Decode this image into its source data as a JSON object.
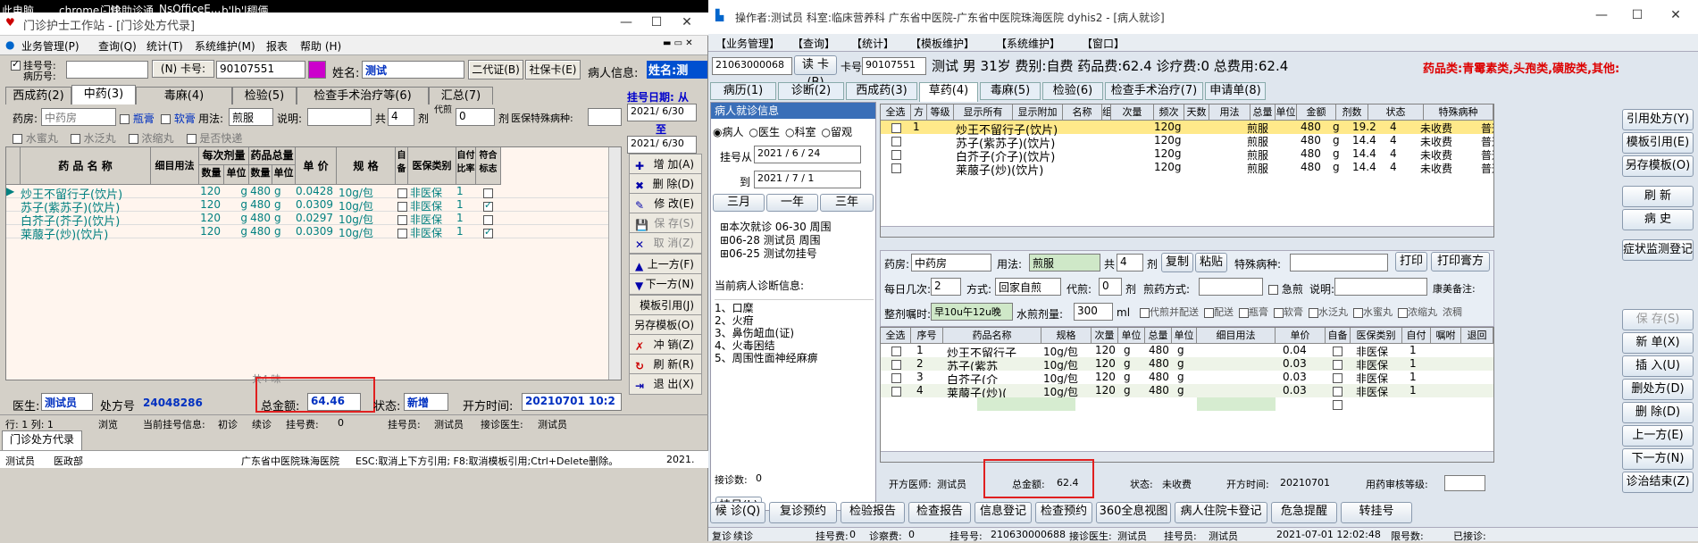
{
  "taskbar": [
    "此电脑",
    "chrome - 快",
    "门诊助诊通",
    "NsOfficeE...",
    "b'lb'l稠俩"
  ],
  "left": {
    "title": "门诊护士工作站 - [门诊处方代录]",
    "menu": [
      "业务管理(P)",
      "查询(Q)",
      "统计(T)",
      "系统维护(M)",
      "报表",
      "帮助 (H)"
    ],
    "reg_label": "挂号号:",
    "rec_label": "病历号:",
    "card_btn": "(N) 卡号:",
    "card_no": "90107551",
    "name_label": "姓名:",
    "name_val": "测试",
    "btn_id2": "二代证(B)",
    "btn_social": "社保卡(E)",
    "patient_info_label": "病人信息:",
    "patient_info_val": "姓名:测",
    "tabs": [
      "西成药(2)",
      "中药(3)",
      "毒麻(4)",
      "检验(5)",
      "检查手术治疗等(6)",
      "汇总(7)"
    ],
    "pharmacy_label": "药房:",
    "pharmacy": "中药房",
    "dict1": "瓶膏",
    "dict2": "软膏",
    "usage_label": "用法:",
    "usage": "煎服",
    "note_label": "说明:",
    "total_label": "共",
    "total": "4",
    "dose_unit": "剂",
    "decoct": "代煎",
    "decoct_val": "0",
    "decoct_unit": "剂",
    "special": "医保特殊病种:",
    "opts": [
      "水蜜丸",
      "水泛丸",
      "浓缩丸",
      "是否快递"
    ],
    "hdr": {
      "name": "药 品 名 称",
      "usage": "细目用法",
      "per": "每次剂量",
      "tot": "药品总量",
      "qty": "数量",
      "unit": "单位",
      "qty2": "数量",
      "unit2": "单位",
      "price": "单 价",
      "spec": "规 格",
      "self": "自备",
      "ins": "医保类别",
      "ratio": "自付比率",
      "flag": "符合标志"
    },
    "rows": [
      {
        "name": "炒王不留行子(饮片)",
        "q": "120",
        "u": "g",
        "q2": "480",
        "u2": "g",
        "price": "0.0428",
        "spec": "10g/包",
        "ins": "非医保",
        "r": "1",
        "f": false
      },
      {
        "name": "苏子(紫苏子)(饮片)",
        "q": "120",
        "u": "g",
        "q2": "480",
        "u2": "g",
        "price": "0.0309",
        "spec": "10g/包",
        "ins": "非医保",
        "r": "1",
        "f": true
      },
      {
        "name": "白芥子(芥子)(饮片)",
        "q": "120",
        "u": "g",
        "q2": "480",
        "u2": "g",
        "price": "0.0297",
        "spec": "10g/包",
        "ins": "非医保",
        "r": "1",
        "f": false
      },
      {
        "name": "莱菔子(炒)(饮片)",
        "q": "120",
        "u": "g",
        "q2": "480",
        "u2": "g",
        "price": "0.0309",
        "spec": "10g/包",
        "ins": "非医保",
        "r": "1",
        "f": true
      }
    ],
    "side_date": "挂号日期: 从",
    "date1": "2021/ 6/30",
    "to": "至",
    "date2": "2021/ 6/30",
    "side_btns": [
      "增 加(A)",
      "删 除(D)",
      "修 改(E)",
      "保 存(S)",
      "取 消(Z)",
      "上一方(F)",
      "下一方(N)",
      "模板引用(J)",
      "另存模板(O)",
      "冲 销(Z)",
      "刷 新(R)",
      "退 出(X)"
    ],
    "faded": "共4  味",
    "doctor_label": "医生:",
    "doctor": "测试员",
    "rx_label": "处方号",
    "rx": "24048286",
    "amt_label": "总金额:",
    "amt": "64.46",
    "state_label": "状态:",
    "state": "新增",
    "open_label": "开方时间:",
    "open": "20210701 10:2",
    "status": [
      "行: 1 列: 1",
      "浏览",
      "当前挂号信息:",
      "初诊",
      "续诊",
      "挂号费:",
      "0",
      "挂号员:",
      "测试员",
      "接诊医生:",
      "测试员"
    ],
    "bottom_tab": "门诊处方代录",
    "foot": [
      "测试员",
      "医政部",
      "广东省中医院珠海医院",
      "ESC:取消上下方引用; F8:取消模板引用;Ctrl+Delete删除。",
      "2021."
    ]
  },
  "right": {
    "title": "操作者:测试员  科室:临床营养科  广东省中医院-广东省中医院珠海医院 dyhis2 - [病人就诊]",
    "menu": [
      "【业务管理】",
      "【查询】",
      "【统计】",
      "【模板维护】",
      "【系统维护】",
      "【窗口】"
    ],
    "reg_no": "21063000068",
    "read_card": "读 卡(B)",
    "card_label": "卡号",
    "card_no": "90107551",
    "pinfo": "测试 男 31岁 费别:自费 药品费:62.4 诊疗费:0 总费用:62.4",
    "drugclass": "药品类:青霉素类,头孢类,磺胺类,其他:",
    "tabs": [
      "病历(1)",
      "诊断(2)",
      "西成药(3)",
      "草药(4)",
      "毒麻(5)",
      "检验(6)",
      "检查手术治疗(7)",
      "申请单(8)"
    ],
    "left_panel_title": "病人就诊信息",
    "radios": [
      "病人",
      "医生",
      "科室",
      "留观"
    ],
    "from_label": "挂号从",
    "from": "2021 / 6 / 24",
    "to_label": "到",
    "to": "2021 / 7 / 1",
    "range": [
      "三月",
      "一年",
      "三年"
    ],
    "visits": [
      "本次就诊 06-30 周围",
      "06-28 测试员 周围",
      "06-25 测试勿挂号"
    ],
    "diag_title": "当前病人诊断信息:",
    "diag": [
      "1、口糜",
      "2、火疳",
      "3、鼻伤衄血(证)",
      "4、火毒困结",
      "5、周围性面神经麻痹"
    ],
    "count_label": "接诊数:",
    "count": "0",
    "reg_btn": "挂号(L)",
    "top_hdr": [
      "全选",
      "方",
      "等级",
      "显示所有",
      "显示附加",
      "名称",
      "组",
      "次量",
      "频次",
      "天数",
      "用法",
      "总量",
      "单位",
      "金额",
      "剂数",
      "状态",
      "特殊病种"
    ],
    "top_rows": [
      {
        "n": "1",
        "name": "炒王不留行子(饮片)",
        "q": "120g",
        "use": "煎服",
        "tot": "480",
        "u": "g",
        "amt": "19.2",
        "d": "4",
        "st": "未收费",
        "sp": "普通待遇"
      },
      {
        "n": "",
        "name": "苏子(紫苏子)(饮片)",
        "q": "120g",
        "use": "煎服",
        "tot": "480",
        "u": "g",
        "amt": "14.4",
        "d": "4",
        "st": "未收费",
        "sp": "普通待遇"
      },
      {
        "n": "",
        "name": "白芥子(介子)(饮片)",
        "q": "120g",
        "use": "煎服",
        "tot": "480",
        "u": "g",
        "amt": "14.4",
        "d": "4",
        "st": "未收费",
        "sp": "普通待遇"
      },
      {
        "n": "",
        "name": "莱菔子(炒)(饮片)",
        "q": "120g",
        "use": "煎服",
        "tot": "480",
        "u": "g",
        "amt": "14.4",
        "d": "4",
        "st": "未收费",
        "sp": "普通待遇"
      }
    ],
    "f": {
      "pharm_label": "药房:",
      "pharm": "中药房",
      "usage_label": "用法:",
      "usage": "煎服",
      "total_label": "共",
      "total": "4",
      "unit": "剂",
      "copy": "复制",
      "paste": "粘贴",
      "special": "特殊病种:",
      "print": "打印",
      "print_rx": "打印膏方",
      "times_label": "每日几次:",
      "times": "2",
      "method_label": "方式:",
      "method": "回家自煎",
      "decoct_label": "代煎:",
      "decoct": "0",
      "decoct_unit": "剂",
      "decoct_way": "煎药方式:",
      "urgent": "急煎",
      "note_label": "说明:",
      "kang": "康美备注:",
      "advice_label": "整剂嘱时:",
      "advice": "早10u午12u晚",
      "water_label": "水煎剂量:",
      "water": "300",
      "ml": "ml",
      "opts": [
        "代煎并配送",
        "配送",
        "瓶膏",
        "软膏",
        "水泛丸",
        "水蜜丸",
        "浓缩丸",
        "浓稠"
      ]
    },
    "bot_hdr": [
      "全选",
      "序号",
      "药品名称",
      "规格",
      "次量",
      "单位",
      "总量",
      "单位",
      "细目用法",
      "单价",
      "自备",
      "医保类别",
      "自付",
      "嘱咐",
      "退回"
    ],
    "bot_rows": [
      {
        "n": "1",
        "name": "炒王不留行子",
        "spec": "10g/包",
        "q": "120",
        "u": "g",
        "t": "480",
        "u2": "g",
        "p": "0.04",
        "ins": "非医保",
        "s": "1"
      },
      {
        "n": "2",
        "name": "苏子(紫苏",
        "spec": "10g/包",
        "q": "120",
        "u": "g",
        "t": "480",
        "u2": "g",
        "p": "0.03",
        "ins": "非医保",
        "s": "1"
      },
      {
        "n": "3",
        "name": "白芥子(介",
        "spec": "10g/包",
        "q": "120",
        "u": "g",
        "t": "480",
        "u2": "g",
        "p": "0.03",
        "ins": "非医保",
        "s": "1"
      },
      {
        "n": "4",
        "name": "莱菔子(炒)(",
        "spec": "10g/包",
        "q": "120",
        "u": "g",
        "t": "480",
        "u2": "g",
        "p": "0.03",
        "ins": "非医保",
        "s": "1"
      }
    ],
    "info": {
      "doc_label": "开方医师:",
      "doc": "测试员",
      "amt_label": "总金额:",
      "amt": "62.4",
      "state_label": "状态:",
      "state": "未收费",
      "time_label": "开方时间:",
      "time": "20210701",
      "audit": "用药审核等级:"
    },
    "side": [
      "引用处方(Y)",
      "模板引用(E)",
      "另存模板(O)",
      "刷 新",
      "病 史",
      "症状监测登记",
      "保 存(S)",
      "新 单(X)",
      "插 入(U)",
      "删处方(D)",
      "删 除(D)",
      "上一方(E)",
      "下一方(N)",
      "诊治结束(Z)"
    ],
    "bottom_btns": [
      "候 诊(Q)",
      "复诊预约",
      "检验报告",
      "检查报告",
      "信息登记",
      "检查预约",
      "360全息视图",
      "病人住院卡登记",
      "危急提醒",
      "转挂号"
    ],
    "status": [
      "复诊",
      "续诊",
      "挂号费:",
      "0",
      "诊察费:",
      "0",
      "挂号号:",
      "210630000688",
      "接诊医生:",
      "测试员",
      "挂号员:",
      "测试员",
      "2021-07-01 12:02:48",
      "限号数:",
      "已接诊:"
    ]
  }
}
